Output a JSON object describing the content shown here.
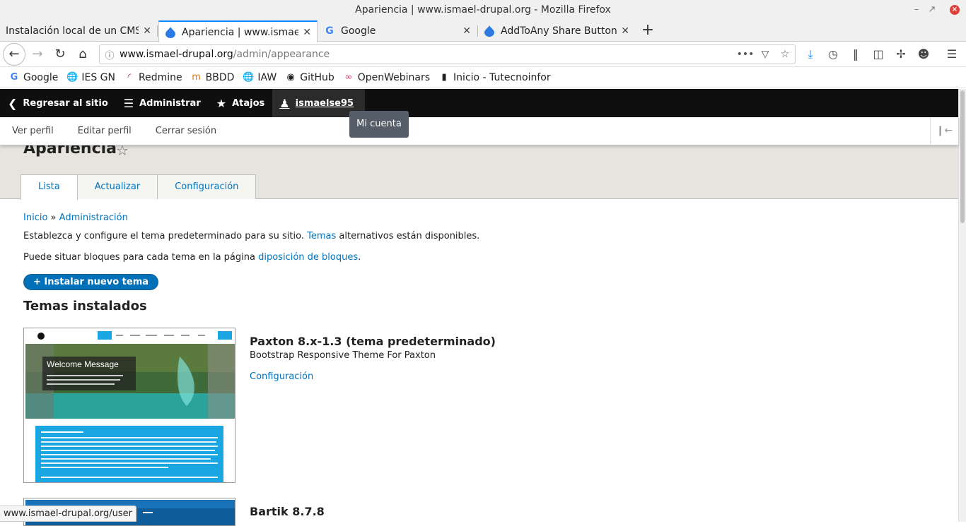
{
  "window": {
    "title": "Apariencia | www.ismael-drupal.org - Mozilla Firefox"
  },
  "tabs": [
    {
      "label": "Instalación local de un CMS P",
      "active": false
    },
    {
      "label": "Apariencia | www.ismael-drup",
      "active": true
    },
    {
      "label": "Google",
      "active": false
    },
    {
      "label": "AddToAny Share Buttons",
      "active": false
    }
  ],
  "urlbar": {
    "domain": "www.ismael-drupal.org",
    "path": "/admin/appearance",
    "more": "•••"
  },
  "bookmarks": [
    "Google",
    "IES GN",
    "Redmine",
    "BBDD",
    "IAW",
    "GitHub",
    "OpenWebinars",
    "Inicio - Tutecnoinfor"
  ],
  "toolbar": {
    "back_to_site": "Regresar al sitio",
    "manage": "Administrar",
    "shortcuts": "Atajos",
    "user": "ismaelse95"
  },
  "tray": {
    "view_profile": "Ver perfil",
    "edit_profile": "Editar perfil",
    "logout": "Cerrar sesión"
  },
  "tooltip": "Mi cuenta",
  "page": {
    "title": "Apariencia",
    "tabs": [
      "Lista",
      "Actualizar",
      "Configuración"
    ],
    "breadcrumb": {
      "home": "Inicio",
      "sep": "»",
      "admin": "Administración"
    },
    "intro_pre": "Establezca y configure el tema predeterminado para su sitio.",
    "intro_link": "Temas",
    "intro_post": "alternativos están disponibles.",
    "blocks_pre": "Puede situar bloques para cada tema en la página",
    "blocks_link": "diposición de bloques",
    "blocks_post": ".",
    "install_button": "+ Instalar nuevo tema",
    "section_title": "Temas instalados"
  },
  "themes": [
    {
      "name": "Paxton 8.x-1.3 (tema predeterminado)",
      "description": "Bootstrap Responsive Theme For Paxton",
      "settings": "Configuración",
      "preview_heading": "Welcome Message"
    },
    {
      "name": "Bartik 8.7.8"
    }
  ],
  "status_url": "www.ismael-drupal.org/user",
  "colors": {
    "toolbar": "#0f0f0f",
    "link": "#0074bd",
    "button": "#0071b8",
    "band": "#e7e4df"
  }
}
